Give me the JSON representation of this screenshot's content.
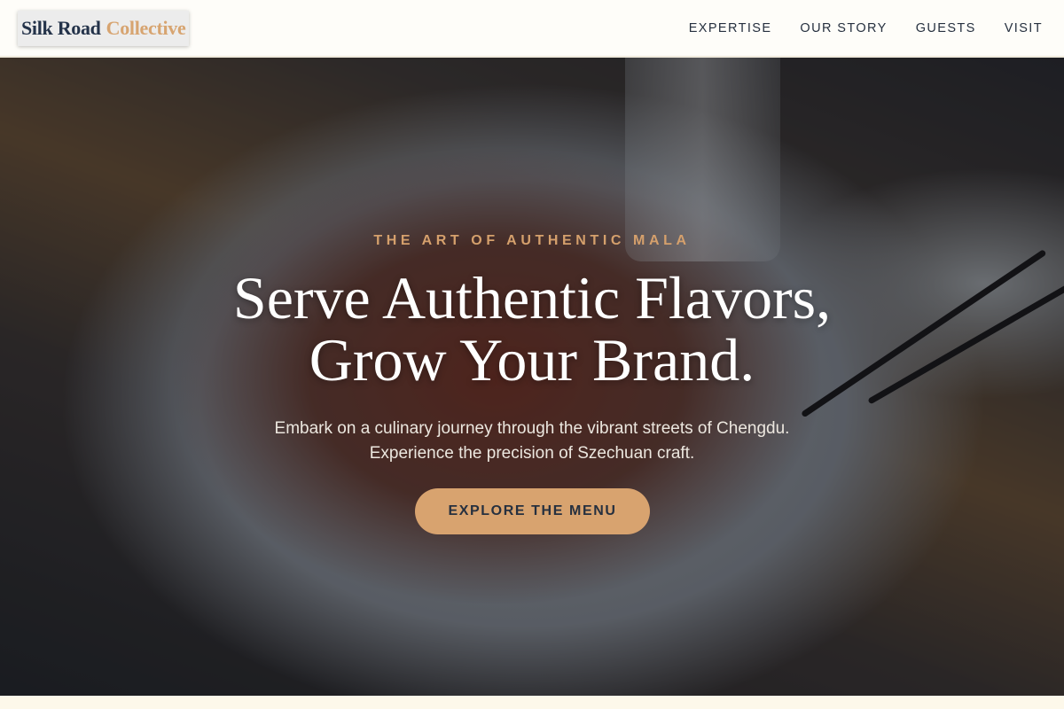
{
  "brand": {
    "name_part1": "Silk Road",
    "name_part2": "Collective"
  },
  "nav": {
    "items": [
      {
        "label": "EXPERTISE"
      },
      {
        "label": "OUR STORY"
      },
      {
        "label": "GUESTS"
      },
      {
        "label": "VISIT"
      }
    ]
  },
  "hero": {
    "eyebrow": "THE ART OF AUTHENTIC MALA",
    "title_line1": "Serve Authentic Flavors,",
    "title_line2": "Grow Your Brand.",
    "subtitle_line1": "Embark on a culinary journey through the vibrant streets of Chengdu.",
    "subtitle_line2": "Experience the precision of Szechuan craft.",
    "cta_label": "EXPLORE THE MENU",
    "image_icon": "food-photo"
  },
  "colors": {
    "accent": "#d8a36f",
    "brand_dark": "#24334a",
    "eyebrow": "#d5a06c"
  }
}
